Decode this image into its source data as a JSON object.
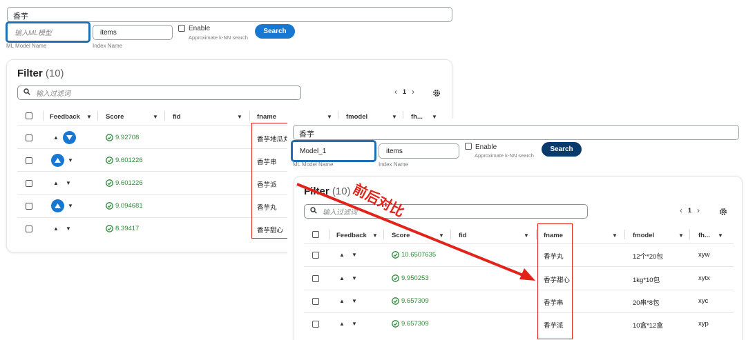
{
  "annotation": {
    "text": "前后对比",
    "color": "#e0241c"
  },
  "before": {
    "query": "香芋",
    "ml_model": {
      "placeholder": "输入ML模型",
      "value": ""
    },
    "ml_model_caption": "ML Model Name",
    "index": {
      "value": "items"
    },
    "index_caption": "Index Name",
    "enable_label": "Enable",
    "knn_label": "Approximate k-NN search",
    "search_label": "Search",
    "filter": {
      "title": "Filter",
      "count": "(10)",
      "placeholder": "输入过滤词"
    },
    "pager": {
      "prev": "‹",
      "page": "1",
      "next": "›"
    },
    "columns": [
      "Feedback",
      "Score",
      "fid",
      "fname",
      "fmodel",
      "fh..."
    ],
    "rows": [
      {
        "score": "9.92708",
        "fname": "香芋地瓜丸",
        "vote": "down"
      },
      {
        "score": "9.601226",
        "fname": "香芋串",
        "vote": "up"
      },
      {
        "score": "9.601226",
        "fname": "香芋派",
        "vote": "none"
      },
      {
        "score": "9.094681",
        "fname": "香芋丸",
        "vote": "up"
      },
      {
        "score": "8.39417",
        "fname": "香芋甜心",
        "vote": "none"
      }
    ]
  },
  "after": {
    "query": "香芋",
    "ml_model": {
      "placeholder": "",
      "value": "Model_1"
    },
    "ml_model_caption": "ML Model Name",
    "index": {
      "value": "items"
    },
    "index_caption": "Index Name",
    "enable_label": "Enable",
    "knn_label": "Approximate k-NN search",
    "search_label": "Search",
    "filter": {
      "title": "Filter",
      "count": "(10)",
      "placeholder": "输入过滤词"
    },
    "pager": {
      "prev": "‹",
      "page": "1",
      "next": "›"
    },
    "columns": [
      "Feedback",
      "Score",
      "fid",
      "fname",
      "fmodel",
      "fh..."
    ],
    "rows": [
      {
        "score": "10.6507635",
        "fname": "香芋丸",
        "fmodel": "12个*20包",
        "fh": "xyw"
      },
      {
        "score": "9.950253",
        "fname": "香芋甜心",
        "fmodel": "1kg*10包",
        "fh": "xytx"
      },
      {
        "score": "9.657309",
        "fname": "香芋串",
        "fmodel": "20串*8包",
        "fh": "xyc"
      },
      {
        "score": "9.657309",
        "fname": "香芋派",
        "fmodel": "10盒*12盒",
        "fh": "xyp"
      }
    ]
  },
  "icons": [
    "search-icon",
    "gear-icon",
    "chevron-left-icon",
    "chevron-right-icon",
    "check-circle-icon",
    "sort-icon",
    "upvote-icon",
    "downvote-icon"
  ],
  "colors": {
    "accent": "#1777d1",
    "score_green": "#2e8b3a",
    "highlight_blue": "#1e6fb5",
    "highlight_red": "#e0241c"
  }
}
